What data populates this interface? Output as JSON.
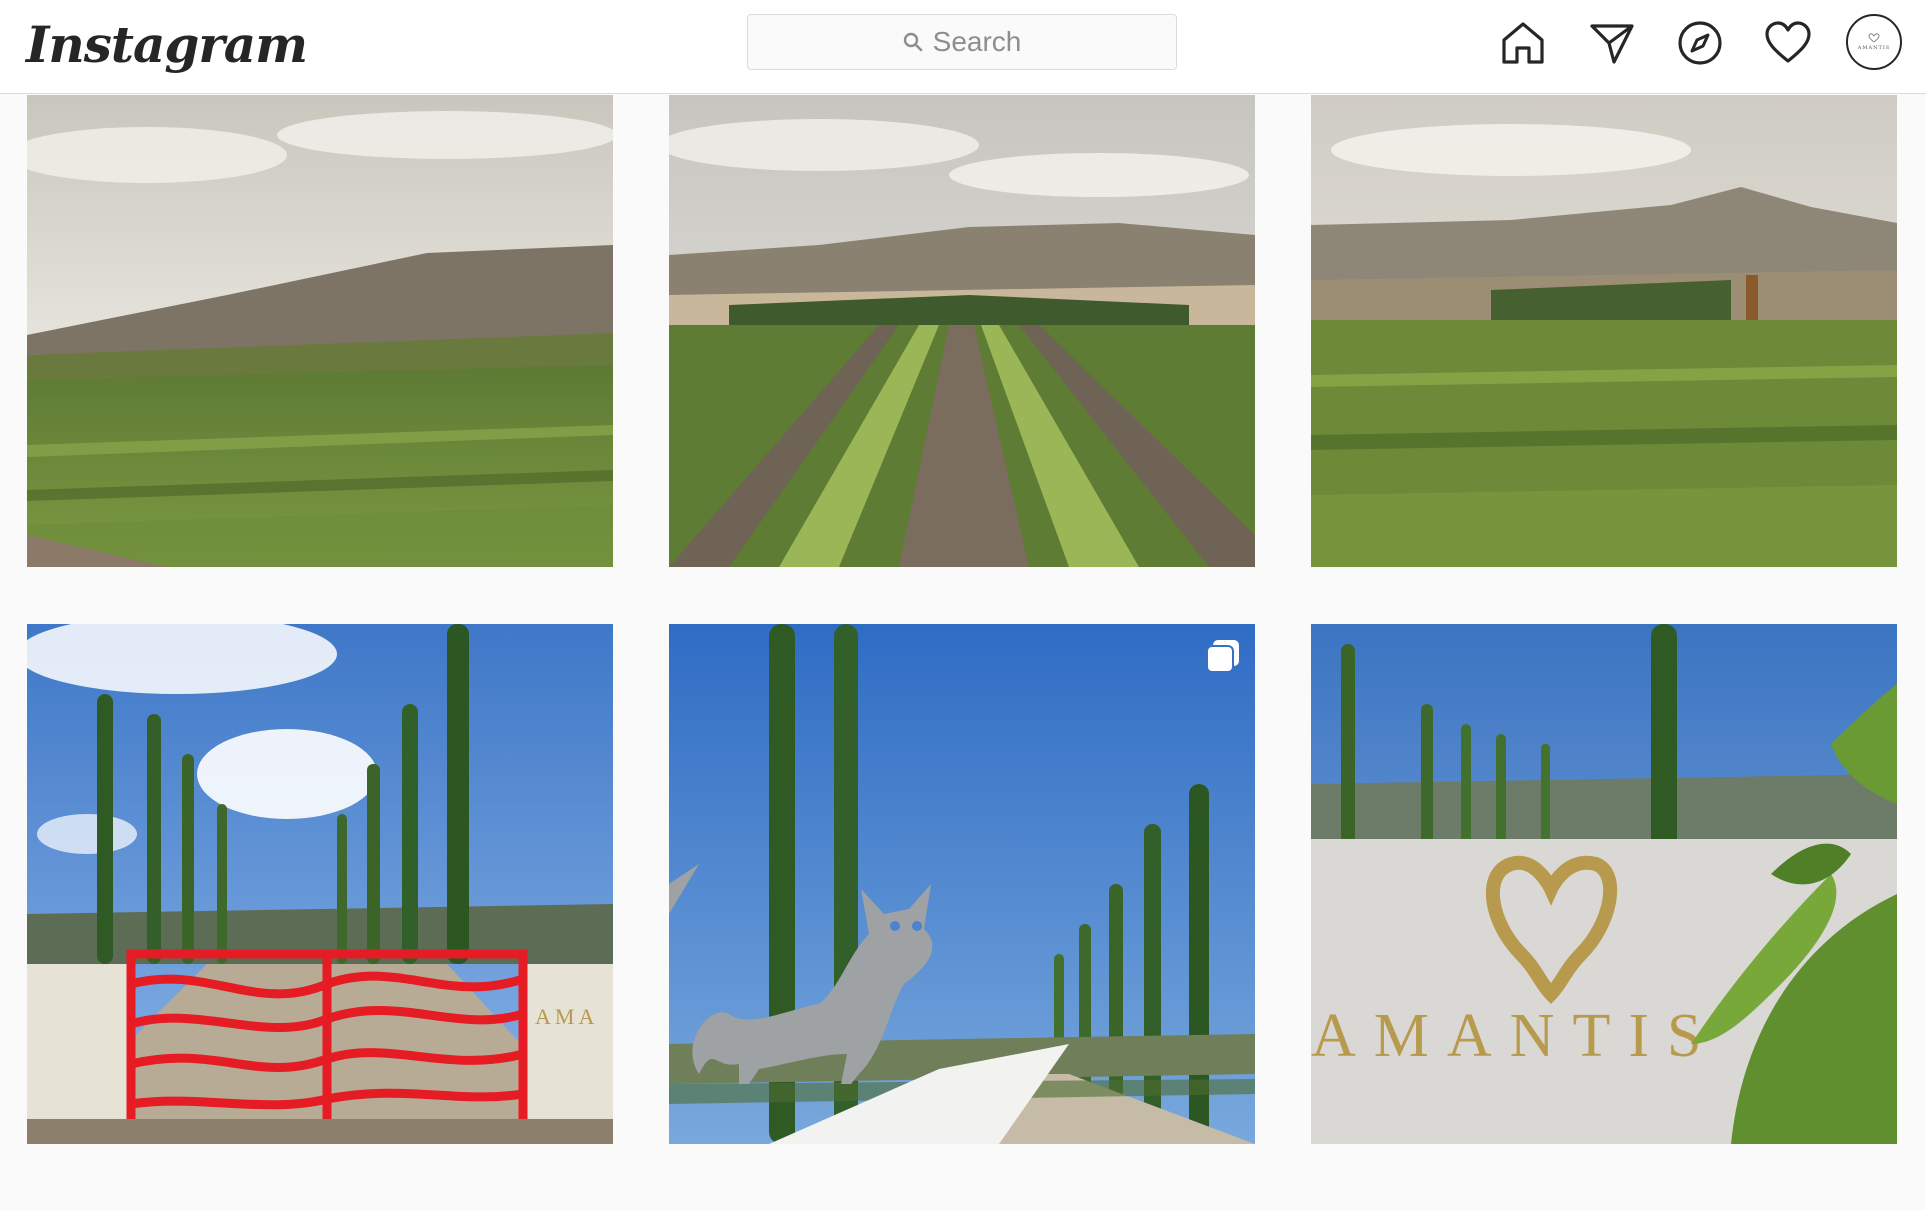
{
  "header": {
    "logo_text": "Instagram",
    "search": {
      "placeholder": "Search",
      "icon": "search-icon"
    },
    "nav_icons": [
      "home-icon",
      "direct-send-icon",
      "explore-compass-icon",
      "activity-heart-icon"
    ],
    "profile_avatar": {
      "icon": "amantis-logo-avatar",
      "brand_text": "AMANTIS"
    }
  },
  "grid": {
    "posts": [
      {
        "subject": "vineyard-hills-left",
        "multi_image": false
      },
      {
        "subject": "vineyard-rows-center",
        "multi_image": false
      },
      {
        "subject": "vineyard-valley-right",
        "multi_image": false
      },
      {
        "subject": "red-gate-cypress-avenue",
        "multi_image": false,
        "sign_text": "AMA"
      },
      {
        "subject": "cat-silhouette-cypress-road",
        "multi_image": true
      },
      {
        "subject": "amantis-sign-wall",
        "multi_image": false,
        "sign_text": "AMANTIS"
      }
    ]
  },
  "colors": {
    "text_primary": "#262626",
    "text_secondary": "#8e8e8e",
    "border": "#dbdbdb",
    "background": "#fafafa",
    "gate_red": "#e51c23",
    "logo_gold": "#b89a4e"
  }
}
